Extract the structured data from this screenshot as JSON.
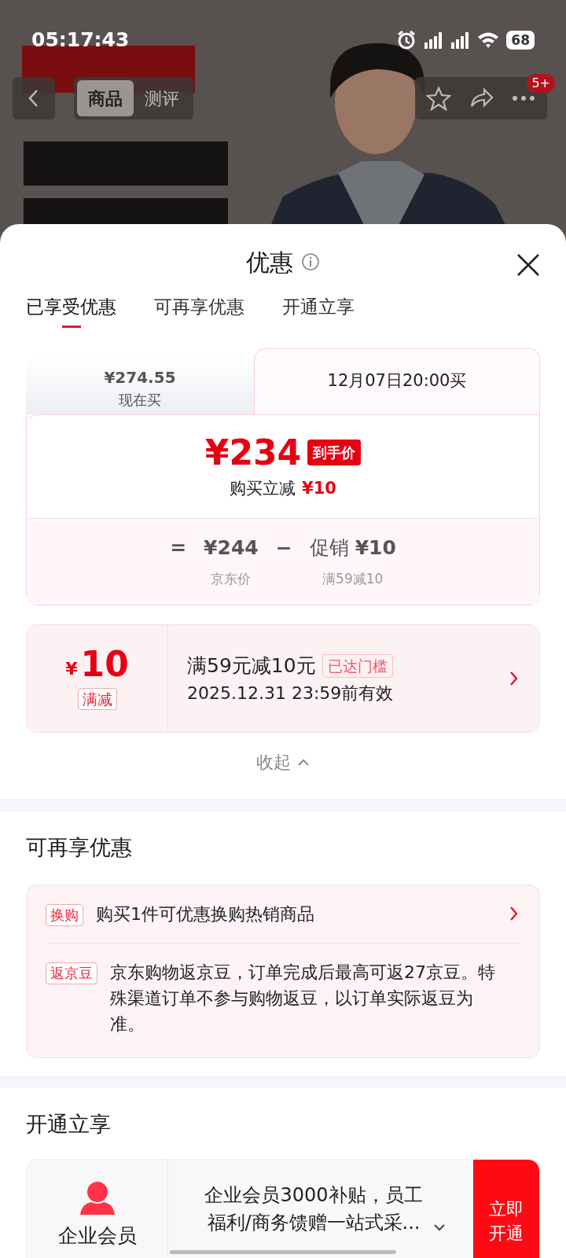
{
  "status_bar": {
    "time": "05:17:43",
    "battery": "68"
  },
  "top_nav": {
    "tabs": [
      {
        "label": "商品",
        "selected": true
      },
      {
        "label": "测评",
        "selected": false
      }
    ],
    "badge": "5+"
  },
  "sheet": {
    "title": "优惠",
    "tabs": [
      {
        "label": "已享受优惠",
        "selected": true
      },
      {
        "label": "可再享优惠",
        "selected": false
      },
      {
        "label": "开通立享",
        "selected": false
      }
    ]
  },
  "price_card": {
    "options": [
      {
        "price": "¥274.55",
        "label": "现在买",
        "selected": false
      },
      {
        "label": "12月07日20:00买",
        "selected": true
      }
    ],
    "final_price": "¥234",
    "final_tag": "到手价",
    "discount_label": "购买立减",
    "discount_amount": "¥10",
    "breakdown": {
      "equals": "=",
      "base": {
        "value": "¥244",
        "caption": "京东价"
      },
      "minus": "−",
      "deduction": {
        "label": "促销",
        "value": "¥10",
        "caption": "满59减10"
      }
    }
  },
  "coupon": {
    "currency": "¥",
    "amount": "10",
    "tag": "满减",
    "title": "满59元减10元",
    "status": "已达门槛",
    "validity": "2025.12.31 23:59前有效"
  },
  "collapse": "收起",
  "more_section": {
    "title": "可再享优惠",
    "items": [
      {
        "kind": "link",
        "tag": "换购",
        "text": "购买1件可优惠换购热销商品"
      },
      {
        "kind": "info",
        "tag": "返京豆",
        "text": "京东购物返京豆，订单完成后最高可返27京豆。特殊渠道订单不参与购物返豆，以订单实际返豆为准。"
      }
    ]
  },
  "open_section": {
    "title": "开通立享",
    "item": {
      "name": "企业会员",
      "description": "企业会员3000补贴，员工福利/商务馈赠一站式采...",
      "button": "立即开通"
    }
  }
}
